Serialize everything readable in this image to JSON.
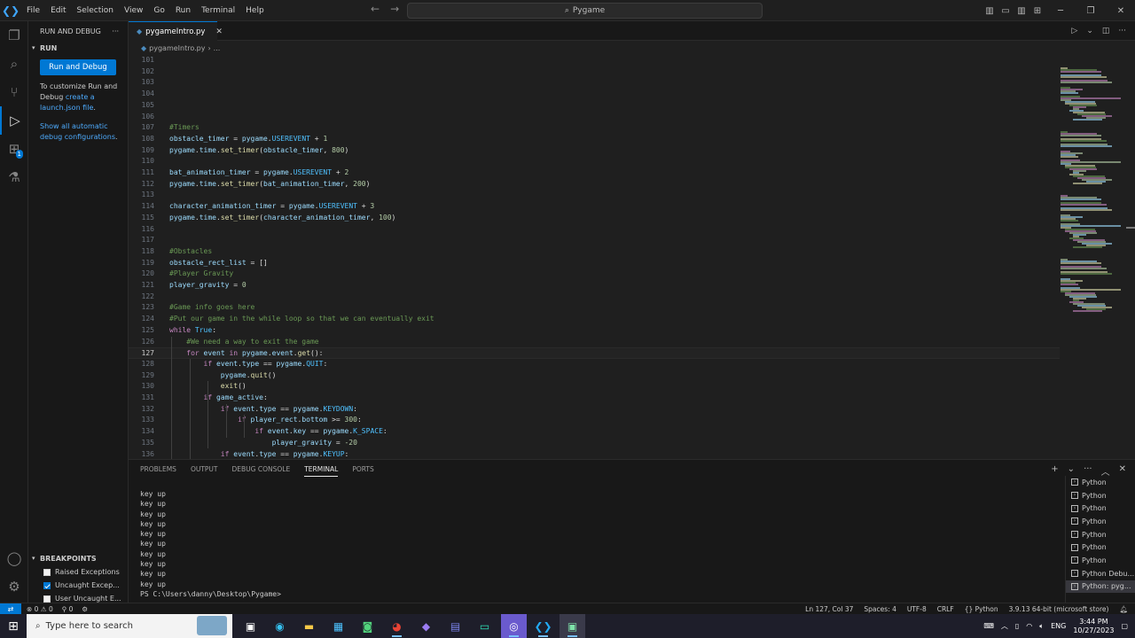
{
  "titlebar": {
    "menu": [
      "File",
      "Edit",
      "Selection",
      "View",
      "Go",
      "Run",
      "Terminal",
      "Help"
    ],
    "command_center": "Pygame"
  },
  "activity_bar": {
    "icons": [
      "explorer-icon",
      "search-icon",
      "source-control-icon",
      "run-debug-icon",
      "extensions-icon",
      "testing-icon"
    ],
    "badge": "1",
    "bottom_icons": [
      "account-icon",
      "manage-gear-icon"
    ]
  },
  "sidebar": {
    "title": "RUN AND DEBUG",
    "section": "RUN",
    "run_button": "Run and Debug",
    "customize_text": "To customize Run and Debug ",
    "customize_link": "create a launch.json file",
    "customize_end": ".",
    "automatic_link": "Show all automatic debug configurations",
    "automatic_end": ".",
    "breakpoints_title": "BREAKPOINTS",
    "breakpoints": [
      {
        "label": "Raised Exceptions",
        "checked": false
      },
      {
        "label": "Uncaught Excep...",
        "checked": true
      },
      {
        "label": "User Uncaught E...",
        "checked": false
      }
    ]
  },
  "editor": {
    "tab": "pygameIntro.py",
    "breadcrumb_file": "pygameIntro.py",
    "breadcrumb_more": "...",
    "current_line": 127,
    "lines": [
      {
        "n": 101,
        "t": ""
      },
      {
        "n": 102,
        "t": ""
      },
      {
        "n": 103,
        "t": ""
      },
      {
        "n": 104,
        "t": ""
      },
      {
        "n": 105,
        "t": ""
      },
      {
        "n": 106,
        "t": ""
      },
      {
        "n": 107,
        "t": "#Timers"
      },
      {
        "n": 108,
        "t": "obstacle_timer = pygame.USEREVENT + 1"
      },
      {
        "n": 109,
        "t": "pygame.time.set_timer(obstacle_timer, 800)"
      },
      {
        "n": 110,
        "t": ""
      },
      {
        "n": 111,
        "t": "bat_animation_timer = pygame.USEREVENT + 2"
      },
      {
        "n": 112,
        "t": "pygame.time.set_timer(bat_animation_timer, 200)"
      },
      {
        "n": 113,
        "t": ""
      },
      {
        "n": 114,
        "t": "character_animation_timer = pygame.USEREVENT + 3"
      },
      {
        "n": 115,
        "t": "pygame.time.set_timer(character_animation_timer, 100)"
      },
      {
        "n": 116,
        "t": ""
      },
      {
        "n": 117,
        "t": ""
      },
      {
        "n": 118,
        "t": "#Obstacles"
      },
      {
        "n": 119,
        "t": "obstacle_rect_list = []"
      },
      {
        "n": 120,
        "t": "#Player Gravity"
      },
      {
        "n": 121,
        "t": "player_gravity = 0"
      },
      {
        "n": 122,
        "t": ""
      },
      {
        "n": 123,
        "t": "#Game info goes here"
      },
      {
        "n": 124,
        "t": "#Put our game in the while loop so that we can eventually exit"
      },
      {
        "n": 125,
        "t": "while True:"
      },
      {
        "n": 126,
        "t": "    #We need a way to exit the game"
      },
      {
        "n": 127,
        "t": "    for event in pygame.event.get():"
      },
      {
        "n": 128,
        "t": "        if event.type == pygame.QUIT:"
      },
      {
        "n": 129,
        "t": "            pygame.quit()"
      },
      {
        "n": 130,
        "t": "            exit()"
      },
      {
        "n": 131,
        "t": "        if game_active:"
      },
      {
        "n": 132,
        "t": "            if event.type == pygame.KEYDOWN:"
      },
      {
        "n": 133,
        "t": "                if player_rect.bottom >= 300:"
      },
      {
        "n": 134,
        "t": "                    if event.key == pygame.K_SPACE:"
      },
      {
        "n": 135,
        "t": "                        player_gravity = -20"
      },
      {
        "n": 136,
        "t": "            if event.type == pygame.KEYUP:"
      }
    ]
  },
  "panel": {
    "tabs": [
      "PROBLEMS",
      "OUTPUT",
      "DEBUG CONSOLE",
      "TERMINAL",
      "PORTS"
    ],
    "active_tab": "TERMINAL",
    "terminal_output": "key up\nkey up\nkey up\nkey up\nkey up\nkey up\nkey up\nkey up\nkey up\nkey up\nPS C:\\Users\\danny\\Desktop\\Pygame>",
    "terminals": [
      "Python",
      "Python",
      "Python",
      "Python",
      "Python",
      "Python",
      "Python",
      "Python Debu...",
      "Python: pyg..."
    ]
  },
  "statusbar": {
    "errors": "0",
    "warnings": "0",
    "ports": "0",
    "position": "Ln 127, Col 37",
    "spaces": "Spaces: 4",
    "encoding": "UTF-8",
    "eol": "CRLF",
    "language": "Python",
    "interpreter": "3.9.13 64-bit (microsoft store)"
  },
  "taskbar": {
    "search_placeholder": "Type here to search",
    "language": "ENG",
    "time": "3:44 PM",
    "date": "10/27/2023"
  },
  "colors": {
    "accent": "#0078d4",
    "keyword": "#c586c0",
    "variable": "#9cdcfe",
    "function": "#dcdcaa",
    "number": "#b5cea8",
    "comment": "#6a9955",
    "constant": "#4fc1ff"
  }
}
